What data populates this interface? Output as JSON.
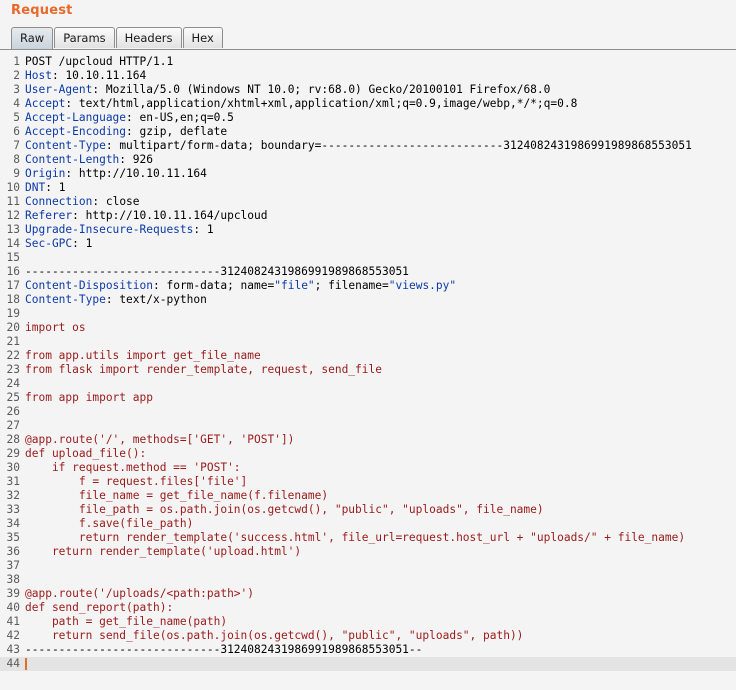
{
  "panel": {
    "title": "Request"
  },
  "tabs": [
    {
      "label": "Raw",
      "active": true
    },
    {
      "label": "Params",
      "active": false
    },
    {
      "label": "Headers",
      "active": false
    },
    {
      "label": "Hex",
      "active": false
    }
  ],
  "colors": {
    "title": "#e8692a",
    "header_name": "#0c3aa8",
    "body_text": "#9a1a1a",
    "caret": "#e8692a"
  },
  "request": {
    "request_line": "POST /upcloud HTTP/1.1",
    "headers": [
      {
        "name": "Host",
        "value": "10.10.11.164"
      },
      {
        "name": "User-Agent",
        "value": "Mozilla/5.0 (Windows NT 10.0; rv:68.0) Gecko/20100101 Firefox/68.0"
      },
      {
        "name": "Accept",
        "value": "text/html,application/xhtml+xml,application/xml;q=0.9,image/webp,*/*;q=0.8"
      },
      {
        "name": "Accept-Language",
        "value": "en-US,en;q=0.5"
      },
      {
        "name": "Accept-Encoding",
        "value": "gzip, deflate"
      },
      {
        "name": "Content-Type",
        "value": "multipart/form-data; boundary=---------------------------312408243198699198986855305​1"
      },
      {
        "name": "Content-Length",
        "value": "926"
      },
      {
        "name": "Origin",
        "value": "http://10.10.11.164"
      },
      {
        "name": "DNT",
        "value": "1"
      },
      {
        "name": "Connection",
        "value": "close"
      },
      {
        "name": "Referer",
        "value": "http://10.10.11.164/upcloud"
      },
      {
        "name": "Upgrade-Insecure-Requests",
        "value": "1"
      },
      {
        "name": "Sec-GPC",
        "value": "1"
      }
    ],
    "boundary_line": "-----------------------------3124082431986991989868553051",
    "part_headers": {
      "disposition_name": "Content-Disposition",
      "disposition_prefix": "form-data; name=",
      "disposition_field": "\"file\"",
      "disposition_mid": "; filename=",
      "disposition_filename": "\"views.py\"",
      "type_name": "Content-Type",
      "type_value": "text/x-python"
    },
    "code_lines": [
      "import os",
      "",
      "from app.utils import get_file_name",
      "from flask import render_template, request, send_file",
      "",
      "from app import app",
      "",
      "",
      "@app.route('/', methods=['GET', 'POST'])",
      "def upload_file():",
      "    if request.method == 'POST':",
      "        f = request.files['file']",
      "        file_name = get_file_name(f.filename)",
      "        file_path = os.path.join(os.getcwd(), \"public\", \"uploads\", file_name)",
      "        f.save(file_path)",
      "        return render_template('success.html', file_url=request.host_url + \"uploads/\" + file_name)",
      "    return render_template('upload.html')",
      "",
      "",
      "@app.route('/uploads/<path:path>')",
      "def send_report(path):",
      "    path = get_file_name(path)",
      "    return send_file(os.path.join(os.getcwd(), \"public\", \"uploads\", path))"
    ],
    "closing_boundary": "-----------------------------3124082431986991989868553051--"
  },
  "line_numbers": [
    "1",
    "2",
    "3",
    "4",
    "5",
    "6",
    "7",
    "8",
    "9",
    "10",
    "11",
    "12",
    "13",
    "14",
    "15",
    "16",
    "17",
    "18",
    "19",
    "20",
    "21",
    "22",
    "23",
    "24",
    "25",
    "26",
    "27",
    "28",
    "29",
    "30",
    "31",
    "32",
    "33",
    "34",
    "35",
    "36",
    "37",
    "38",
    "39",
    "40",
    "41",
    "42",
    "43",
    "44"
  ]
}
